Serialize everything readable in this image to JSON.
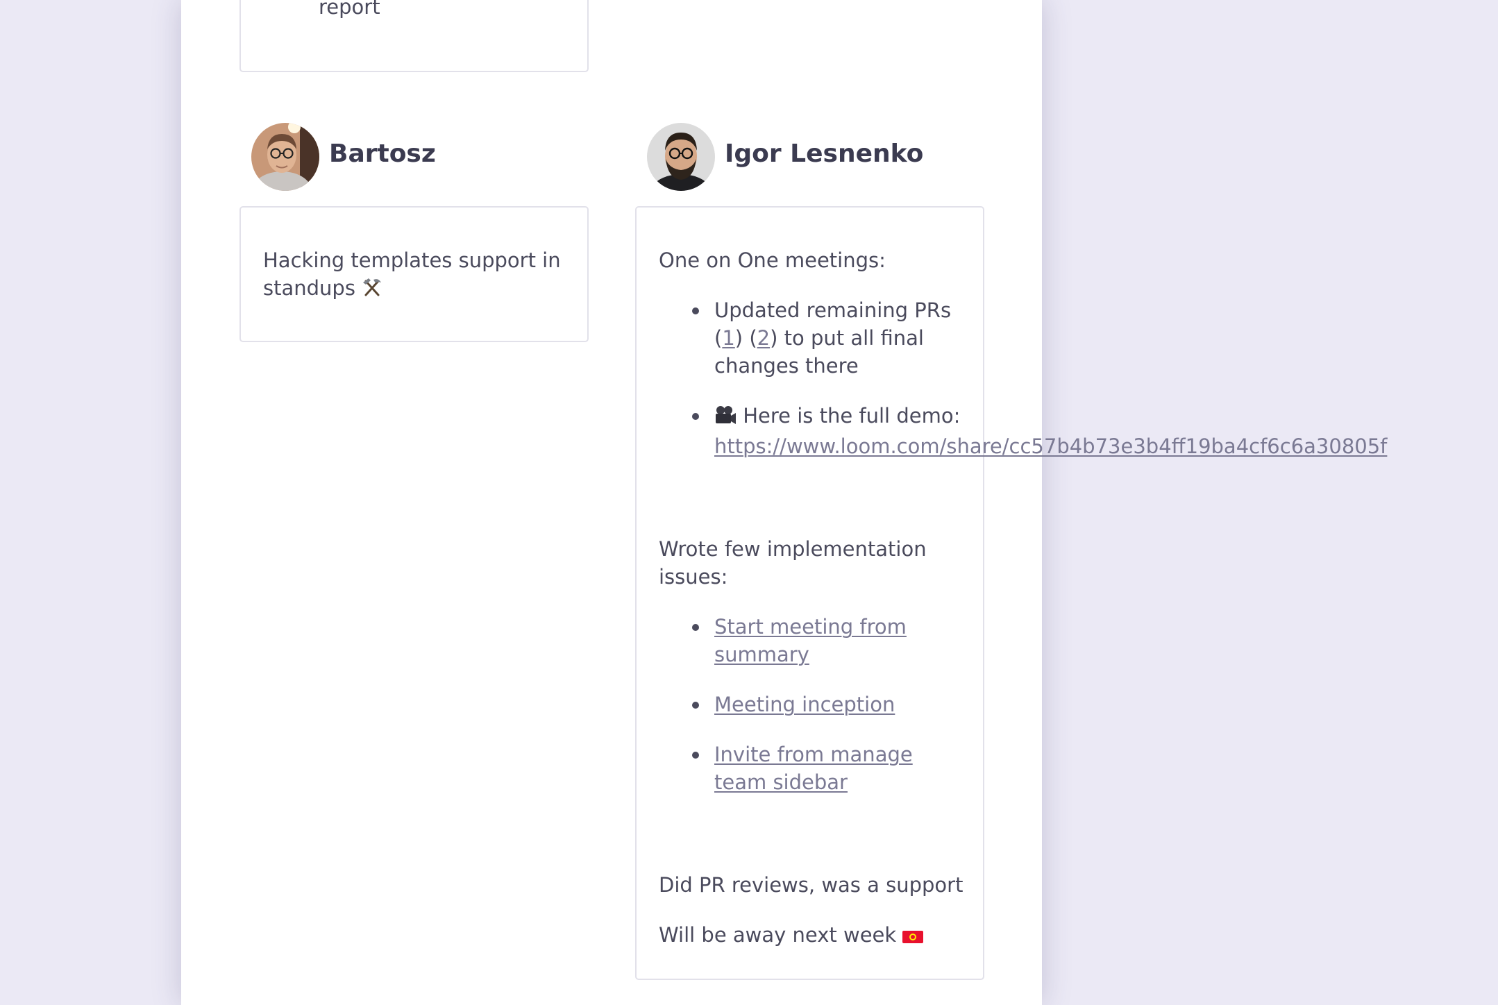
{
  "previous_card": {
    "tail_text": "report"
  },
  "members": [
    {
      "name": "Bartosz",
      "update": {
        "text": "Hacking templates support in standups",
        "emoji_icon": "hammer-and-pick-icon"
      }
    },
    {
      "name": "Igor Lesnenko",
      "sections": {
        "one_on_one_title": "One on One meetings:",
        "item1": {
          "prefix": "Updated remaining PRs",
          "paren_open_1": "(",
          "link1": "1",
          "paren_close_1": ")",
          "paren_open_2": "(",
          "link2": "2",
          "paren_close_2": ")",
          "suffix": "to put all final changes there"
        },
        "item2": {
          "emoji_icon": "movie-camera-icon",
          "text": "Here is the full demo:",
          "link": "https://www.loom.com/share/cc57b4b73e3b4ff19ba4cf6c6a30805f"
        },
        "issues_title": "Wrote few implementation issues:",
        "issues": [
          "Start meeting from summary",
          "Meeting inception",
          "Invite from manage team sidebar"
        ],
        "pr_reviews": "Did PR reviews, was a support",
        "away": "Will be away next week",
        "away_emoji_icon": "kyrgyzstan-flag-icon"
      }
    }
  ],
  "colors": {
    "background": "#ebe9f5",
    "text": "#4a4a5c",
    "link": "#7a7993",
    "card_border": "#e2e1ea"
  }
}
